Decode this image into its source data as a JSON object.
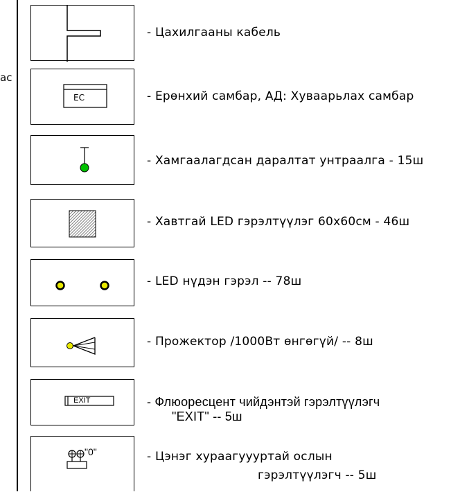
{
  "edge_text": "ac",
  "legend": [
    {
      "symbol": "cable-icon",
      "description": "- Цахилгааны кабель"
    },
    {
      "symbol": "panel-icon",
      "symbol_text": "EC",
      "description": "- Ерөнхий самбар, АД: Хуваарьлах самбар"
    },
    {
      "symbol": "switch-icon",
      "description": "- Хамгаалагдсан даралтат унтраалга - 15ш"
    },
    {
      "symbol": "led-panel-icon",
      "description": "- Хавтгай LED гэрэлтүүлэг 60x60см - 46ш"
    },
    {
      "symbol": "led-eye-icon",
      "description": "- LED нүдэн гэрэл -- 78ш"
    },
    {
      "symbol": "projector-icon",
      "description": "- Прожектор /1000Вт өнгөгүй/ -- 8ш"
    },
    {
      "symbol": "exit-sign-icon",
      "symbol_text": "EXIT",
      "description_line1": "- Флюоресцент чийдэнтэй гэрэлтүүлэгч",
      "description_line2": "\"EXIT\" -- 5ш"
    },
    {
      "symbol": "emergency-light-icon",
      "symbol_text": "\"0\"",
      "description_line1": "- Цэнэг хураагуууртай ослын",
      "description_line2": "гэрэлтүүлэгч -- 5ш"
    }
  ],
  "colors": {
    "green": "#00c000",
    "yellow": "#e8e800",
    "hatch": "#555555"
  }
}
